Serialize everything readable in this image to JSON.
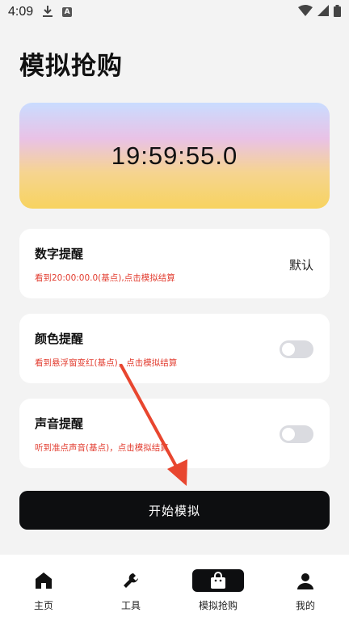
{
  "status_bar": {
    "time": "4:09",
    "a_badge": "A"
  },
  "page": {
    "title": "模拟抢购"
  },
  "clock": {
    "time": "19:59:55.0"
  },
  "settings": [
    {
      "title": "数字提醒",
      "description": "看到20:00:00.0(基点),点击模拟结算",
      "value": "默认"
    },
    {
      "title": "颜色提醒",
      "description": "看到悬浮窗变红(基点)，点击模拟结算",
      "toggle_on": false
    },
    {
      "title": "声音提醒",
      "description": "听到准点声音(基点)，点击模拟结算",
      "toggle_on": false
    }
  ],
  "start_button": {
    "label": "开始模拟"
  },
  "bottom_nav": [
    {
      "label": "主页",
      "icon": "home-icon",
      "active": false
    },
    {
      "label": "工具",
      "icon": "wrench-icon",
      "active": false
    },
    {
      "label": "模拟抢购",
      "icon": "shopping-bag-icon",
      "active": true
    },
    {
      "label": "我的",
      "icon": "person-icon",
      "active": false
    }
  ],
  "colors": {
    "accent": "#0d0e10",
    "warning_text": "#e23b2e",
    "arrow": "#e8462f"
  }
}
